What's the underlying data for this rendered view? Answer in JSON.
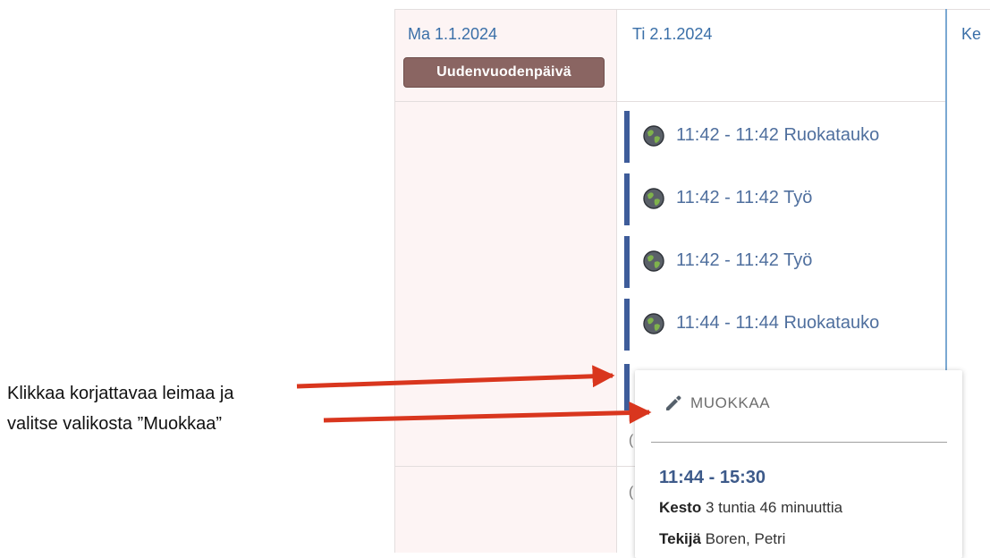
{
  "calendar": {
    "days": [
      {
        "label": "Ma 1.1.2024"
      },
      {
        "label": "Ti 2.1.2024"
      },
      {
        "label": "Ke"
      }
    ],
    "holiday_badge": "Uudenvuodenpäivä",
    "events": [
      {
        "label": "11:42 - 11:42 Ruokatauko",
        "icon": "globe-icon"
      },
      {
        "label": "11:42 - 11:42 Työ",
        "icon": "globe-icon"
      },
      {
        "label": "11:42 - 11:42 Työ",
        "icon": "globe-icon"
      },
      {
        "label": "11:44 - 11:44 Ruokatauko",
        "icon": "globe-icon"
      }
    ],
    "ghost_text": [
      "(",
      "("
    ]
  },
  "popup": {
    "edit_label": "MUOKKAA",
    "edit_icon": "pencil-icon",
    "time": "11:44 - 15:30",
    "duration_label": "Kesto",
    "duration_value": "3 tuntia 46 minuuttia",
    "author_label": "Tekijä",
    "author_value": "Boren, Petri"
  },
  "annotation": {
    "line1": "Klikkaa korjattavaa leimaa ja",
    "line2": "valitse valikosta ”Muokkaa”",
    "arrow_color": "#d9361e"
  },
  "colors": {
    "bar": "#3e5c9a",
    "link": "#4f6f9e",
    "holiday_badge": "#8a6562",
    "today_border": "#7aa8d2"
  }
}
